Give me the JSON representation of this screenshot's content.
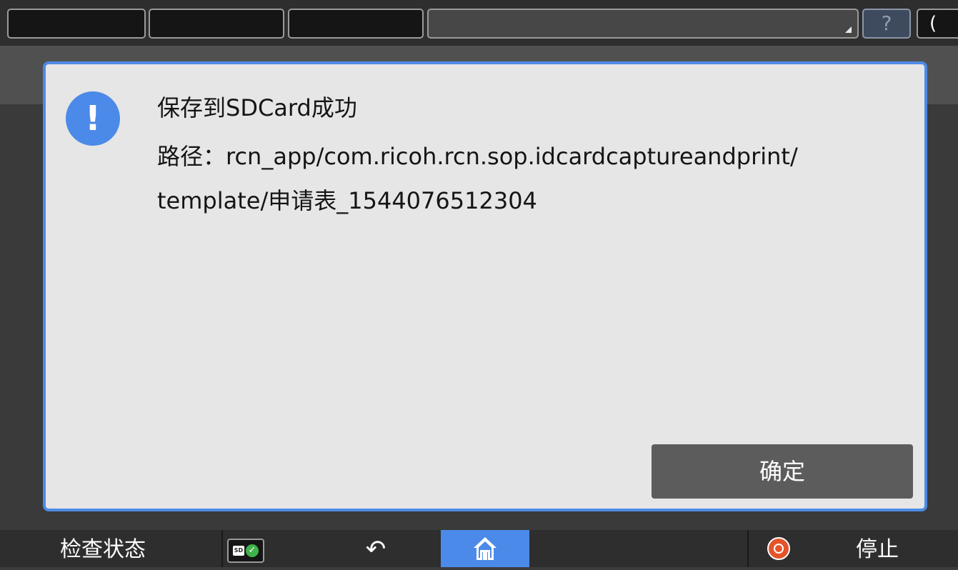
{
  "topbar": {
    "help_glyph": "?",
    "energy_glyph": "("
  },
  "dialog": {
    "icon": "alert-info-icon",
    "title": "保存到SDCard成功",
    "path_line1": "路径：rcn_app/com.ricoh.rcn.sop.idcardcaptureandprint/",
    "path_line2": "template/申请表_1544076512304",
    "ok_label": "确定"
  },
  "bottombar": {
    "check_status_label": "检查状态",
    "sd_label": "SD",
    "back_glyph": "↶",
    "stop_label": "停止"
  },
  "colors": {
    "accent": "#4b8ae8",
    "dialog_bg": "#e6e6e6",
    "stop": "#e4542a",
    "sd_ok": "#3fb24a"
  }
}
